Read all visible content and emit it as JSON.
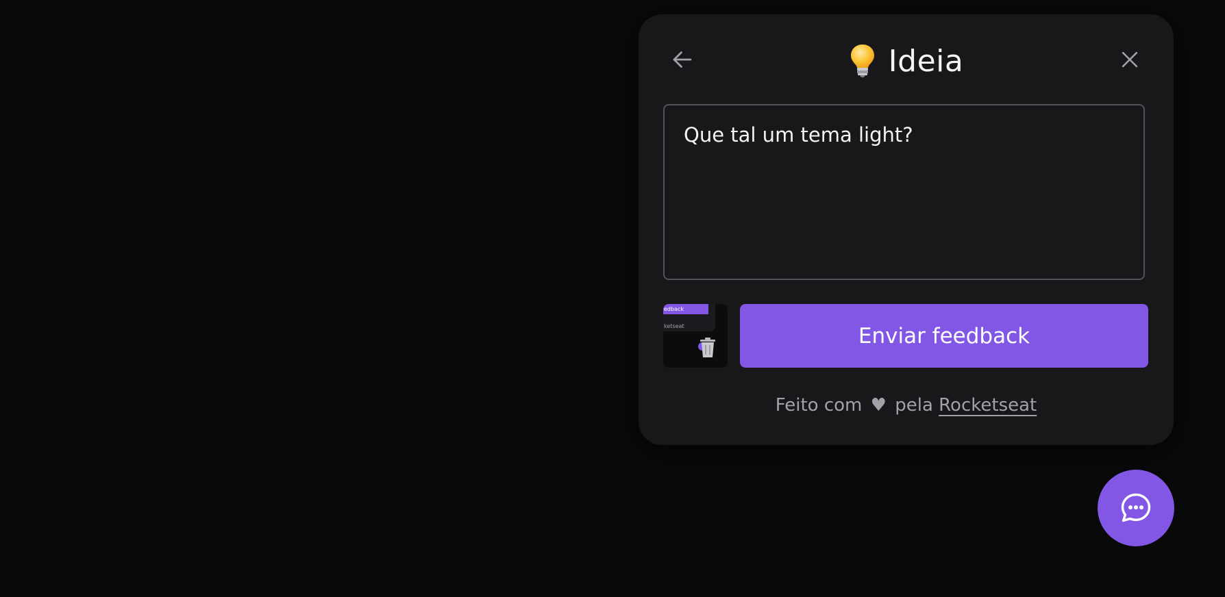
{
  "widget": {
    "title": "Ideia",
    "title_icon": "lightbulb-icon",
    "back_icon": "arrow-left-icon",
    "close_icon": "close-icon",
    "textarea_value": "Que tal um tema light?",
    "screenshot": {
      "thumb_bar_text": "edback",
      "thumb_small_text": "ketseat",
      "trash_icon": "trash-icon"
    },
    "submit_label": "Enviar feedback",
    "footer": {
      "prefix": "Feito com",
      "heart": "♥",
      "middle": "pela",
      "link": "Rocketseat"
    }
  },
  "fab": {
    "icon": "chat-bubble-icon"
  },
  "colors": {
    "background": "#09090a",
    "panel": "#18181b",
    "brand": "#8257e5",
    "border": "#52525b",
    "text": "#f4f4f5",
    "muted": "#a1a1aa"
  }
}
